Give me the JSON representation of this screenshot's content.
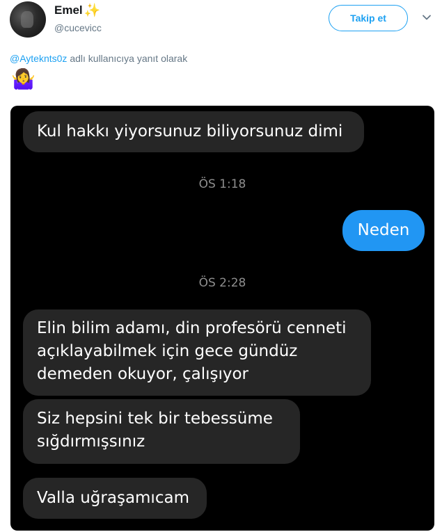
{
  "header": {
    "name": "Emel",
    "handle": "@cucevicc",
    "follow_label": "Takip et"
  },
  "reply": {
    "mention": "@Ayteknts0z",
    "suffix": " adlı kullanıcıya yanıt olarak"
  },
  "tweet": {
    "emoji": "🤷‍♀️"
  },
  "chat": {
    "msg1": "Kul hakkı yiyorsunuz biliyorsunuz dimi",
    "time1": "ÖS 1:18",
    "out1": "Neden",
    "time2": "ÖS 2:28",
    "msg2_line1": "Elin bilim adamı, din profesörü cenneti",
    "msg2_line2": "açıklayabilmek için gece gündüz",
    "msg2_line3": "demeden okuyor, çalışıyor",
    "msg3_line1": "Siz hepsini tek bir tebessüme",
    "msg3_line2": "sığdırmışsınız",
    "msg4": "Valla uğraşamıcam"
  },
  "colors": {
    "accent": "#1da1f2",
    "outgoing_bubble": "#2196f3",
    "incoming_bubble": "#262626"
  },
  "icons": [
    "avatar",
    "sparkle-icon",
    "chevron-down-icon"
  ]
}
